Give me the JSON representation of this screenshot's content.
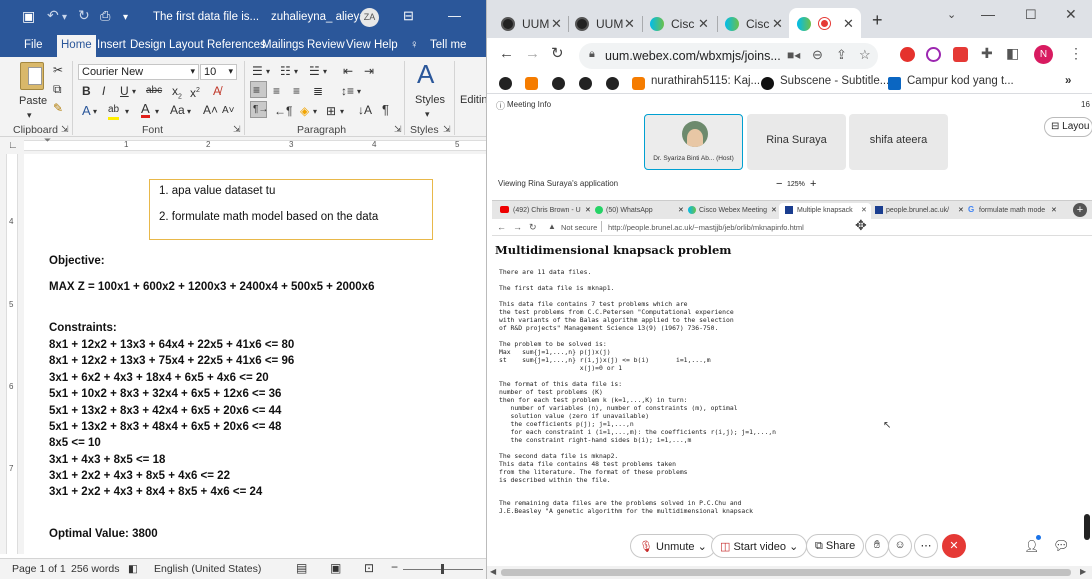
{
  "word": {
    "title": "The first data file is...",
    "account": "zuhalieyna_ alieya",
    "avatar_initials": "ZA",
    "tabs": [
      "File",
      "Home",
      "Insert",
      "Design",
      "Layout",
      "References",
      "Mailings",
      "Review",
      "View",
      "Help"
    ],
    "tell_me": "Tell me",
    "font_name": "Courier New",
    "font_size": "10",
    "paste_label": "Paste",
    "styles_label": "Styles",
    "editing_label": "Editin",
    "group_labels": {
      "clipboard": "Clipboard",
      "font": "Font",
      "paragraph": "Paragraph",
      "styles": "Styles"
    },
    "textbox_items": [
      "1. apa value dataset tu",
      "2. formulate math model based on the data"
    ],
    "doc": {
      "objective_heading": "Objective:",
      "objective": "MAX Z = 100x1 + 600x2 + 1200x3 + 2400x4 + 500x5 + 2000x6",
      "constraints_heading": "Constraints:",
      "constraints": [
        "8x1 + 12x2 + 13x3 + 64x4 + 22x5 + 41x6 <= 80",
        "8x1 + 12x2 + 13x3 + 75x4 + 22x5 + 41x6 <= 96",
        "3x1 + 6x2 + 4x3 + 18x4 + 6x5 + 4x6 <= 20",
        "5x1 + 10x2 + 8x3 + 32x4 + 6x5 + 12x6 <= 36",
        "5x1 + 13x2 + 8x3 + 42x4 + 6x5 + 20x6 <= 44",
        "5x1 + 13x2 + 8x3 + 48x4 + 6x5 + 20x6 <= 48",
        "8x5 <= 10",
        "3x1 + 4x3 + 8x5 <= 18",
        "3x1 + 2x2 + 4x3 + 8x5 + 4x6 <= 22",
        "3x1 + 2x2 + 4x3 + 8x4 + 8x5 + 4x6 <= 24"
      ],
      "optimal": "Optimal Value: 3800"
    },
    "status": {
      "page": "Page 1 of 1",
      "words": "256 words",
      "language": "English (United States)"
    },
    "ruler_numbers": [
      "1",
      "2",
      "3",
      "4",
      "5"
    ],
    "vruler_numbers": [
      "4",
      "5",
      "6",
      "7"
    ]
  },
  "chrome": {
    "tabs": [
      {
        "label": "UUM",
        "icon": "webex-icon"
      },
      {
        "label": "UUM",
        "icon": "webex-icon"
      },
      {
        "label": "Cisc",
        "icon": "webex-icon"
      },
      {
        "label": "Cisc",
        "icon": "webex-icon"
      },
      {
        "label": "",
        "icon": "webex-icon"
      }
    ],
    "url": "uum.webex.com/wbxmjs/joins...",
    "profile_initial": "N",
    "bookmarks": [
      "nurathirah5115: Kaj...",
      "Subscene - Subtitle...",
      "Campur kod yang t..."
    ],
    "colors": {
      "accent": "#1a73e8",
      "word_blue": "#2b579a",
      "end_red": "#e53935"
    }
  },
  "webex": {
    "meeting_info": "Meeting Info",
    "participant_count": "16",
    "layout_label": "Layou",
    "participants": [
      "Dr. Syariza Binti Ab... (Host)",
      "Rina Suraya",
      "shifa ateera"
    ],
    "viewing": "Viewing Rina Suraya's application",
    "zoom": "125%",
    "shared": {
      "tabs": [
        "(492) Chris Brown - U",
        "(50) WhatsApp",
        "Cisco Webex Meeting",
        "Multiple knapsack",
        "people.brunel.ac.uk/",
        "formulate math mode"
      ],
      "not_secure": "Not secure",
      "url": "http://people.brunel.ac.uk/~mastjjb/jeb/orlib/mknapinfo.html",
      "heading": "Multidimensional knapsack problem",
      "paragraphs": [
        "There are 11 data files.",
        "The first data file is mknap1.",
        "This data file contains 7 test problems which are\nthe test problems from C.C.Petersen \"Computational experience\nwith variants of the Balas algorithm applied to the selection\nof R&D projects\" Management Science 13(9) (1967) 736-750.",
        "The problem to be solved is:\nMax   sum{j=1,...,n} p(j)x(j)\nst    sum{j=1,...,n} r(i,j)x(j) <= b(i)       i=1,...,m\n                     x(j)=0 or 1",
        "The format of this data file is:\nnumber of test problems (K)\nthen for each test problem k (k=1,...,K) in turn:\n   number of variables (n), number of constraints (m), optimal\n   solution value (zero if unavailable)\n   the coefficients p(j); j=1,...,n\n   for each constraint i (i=1,...,m): the coefficients r(i,j); j=1,...,n\n   the constraint right-hand sides b(i); i=1,...,m",
        "The second data file is mknap2.\nThis data file contains 48 test problems taken\nfrom the literature. The format of these problems\nis described within the file.",
        "The remaining data files are the problems solved in P.C.Chu and\nJ.E.Beasley \"A genetic algorithm for the multidimensional knapsack"
      ]
    },
    "controls": {
      "unmute": "Unmute",
      "start_video": "Start video",
      "share": "Share"
    }
  }
}
